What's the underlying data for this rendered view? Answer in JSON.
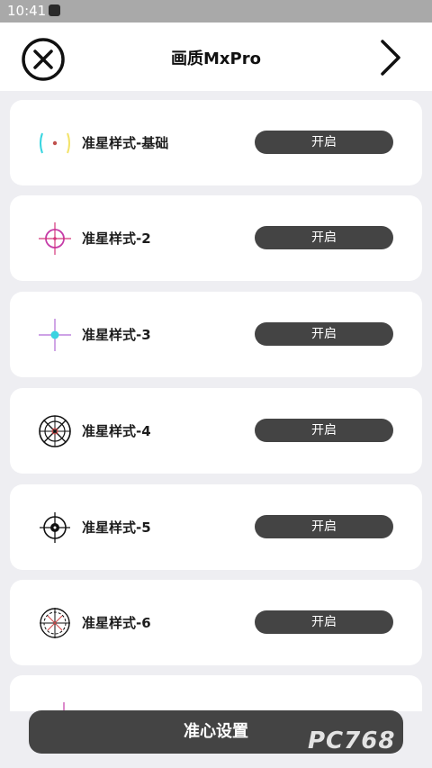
{
  "status_bar": {
    "time": "10:41"
  },
  "header": {
    "title": "画质MxPro",
    "close_icon": "close-circle-icon",
    "next_icon": "chevron-right-icon"
  },
  "items": [
    {
      "label": "准星样式-基础",
      "toggle": "开启",
      "icon": "crosshair-basic-icon"
    },
    {
      "label": "准星样式-2",
      "toggle": "开启",
      "icon": "crosshair-circle-icon"
    },
    {
      "label": "准星样式-3",
      "toggle": "开启",
      "icon": "crosshair-cross-icon"
    },
    {
      "label": "准星样式-4",
      "toggle": "开启",
      "icon": "crosshair-scope-icon"
    },
    {
      "label": "准星样式-5",
      "toggle": "开启",
      "icon": "crosshair-target-icon"
    },
    {
      "label": "准星样式-6",
      "toggle": "开启",
      "icon": "crosshair-ring-icon"
    }
  ],
  "bottom_button": {
    "label": "准心设置"
  },
  "watermark": {
    "text": "PC768"
  },
  "colors": {
    "toggle_bg": "#444444",
    "background": "#eeeef2",
    "card": "#ffffff",
    "status_bar": "#a9a9a9"
  }
}
